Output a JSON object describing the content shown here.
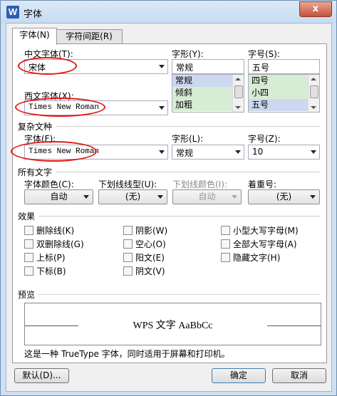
{
  "window": {
    "title": "字体",
    "app_icon": "W",
    "close": "x"
  },
  "tabs": [
    {
      "label": "字体(N)"
    },
    {
      "label": "字符间距(R)"
    }
  ],
  "chinese_font": {
    "label": "中文字体(T):",
    "value": "宋体"
  },
  "style": {
    "label": "字形(Y):",
    "value": "常规",
    "options": [
      "常规",
      "倾斜",
      "加粗"
    ]
  },
  "size": {
    "label": "字号(S):",
    "value": "五号",
    "options": [
      "四号",
      "小四",
      "五号"
    ]
  },
  "western_font": {
    "label": "西文字体(X):",
    "value": "Times New Roman"
  },
  "complex": {
    "section": "复杂文种",
    "font_label": "字体(F):",
    "font_value": "Times New Roman",
    "style_label": "字形(L):",
    "style_value": "常规",
    "size_label": "字号(Z):",
    "size_value": "10"
  },
  "all_text": {
    "section": "所有文字",
    "color_label": "字体颜色(C):",
    "color_value": "自动",
    "underline_label": "下划线线型(U):",
    "underline_value": "(无)",
    "underline_color_label": "下划线颜色(I):",
    "underline_color_value": "自动",
    "emphasis_label": "着重号:",
    "emphasis_value": "(无)"
  },
  "effects": {
    "section": "效果",
    "items": [
      "删除线(K)",
      "双删除线(G)",
      "上标(P)",
      "下标(B)",
      "阴影(W)",
      "空心(O)",
      "阳文(E)",
      "阴文(V)",
      "小型大写字母(M)",
      "全部大写字母(A)",
      "隐藏文字(H)"
    ]
  },
  "preview": {
    "section": "预览",
    "sample": "WPS 文字 AaBbCc",
    "note": "这是一种 TrueType 字体，同时适用于屏幕和打印机。"
  },
  "buttons": {
    "default": "默认(D)...",
    "ok": "确定",
    "cancel": "取消"
  },
  "colors": {
    "annotation": "#e01818",
    "list_bg": "#d7ecd5",
    "list_selected": "#cdd8ee"
  }
}
